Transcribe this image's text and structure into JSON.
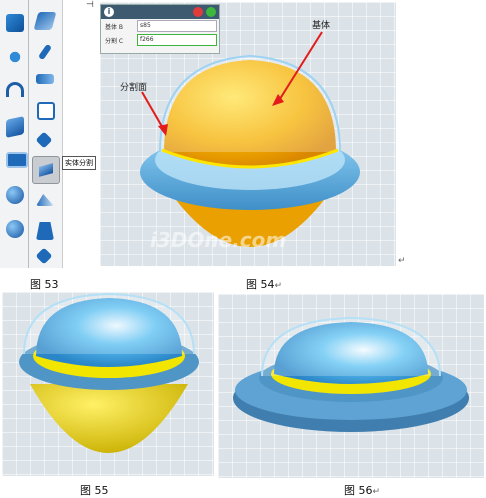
{
  "fig53": {
    "caption": "图 53",
    "left_tools": [
      "cube-icon",
      "move-icon",
      "magnet-icon",
      "layers-icon",
      "panel-icon",
      "sphere-icon",
      "sphere-icon"
    ],
    "right_tools": [
      "sketch-icon",
      "pin-icon",
      "loft-icon",
      "box-icon",
      "cut-icon",
      "split-icon",
      "blade-icon",
      "trapezoid-icon",
      "diamond-icon"
    ],
    "tooltip": "实体分割"
  },
  "fig54": {
    "caption": "图 54",
    "caption_mark": "↵",
    "dialog": {
      "field_b_label": "基体 B",
      "field_b_value": "s85",
      "field_c_label": "分割 C",
      "field_c_value": "f266"
    },
    "callout_base": "基体",
    "callout_split": "分割面",
    "watermark": "i3DOne.com",
    "return_mark": "↵"
  },
  "fig55": {
    "caption": "图 55"
  },
  "fig56": {
    "caption": "图 56",
    "caption_mark": "↵"
  },
  "colors": {
    "yellow": "#f2d500",
    "orange": "#f0a400",
    "blue": "#4db3ec",
    "rim": "#5a9ccc"
  }
}
